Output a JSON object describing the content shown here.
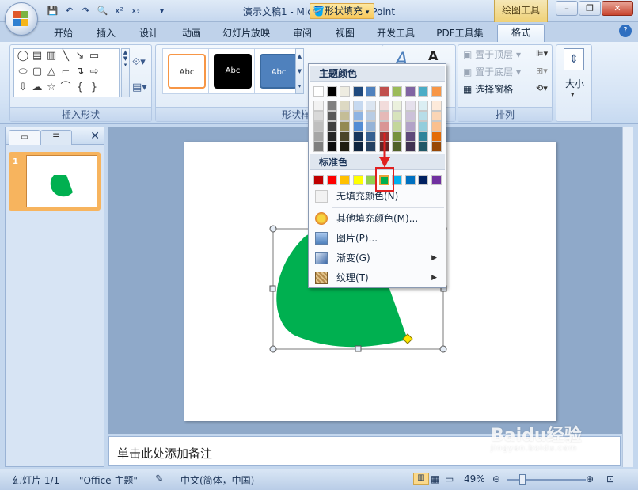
{
  "window": {
    "title": "演示文稿1 - Microsoft PowerPoint",
    "context_tab_title": "绘图工具",
    "controls": [
      "–",
      "❐",
      "✕"
    ]
  },
  "qat": [
    "💾",
    "↶",
    "↷",
    "🔍",
    "x²",
    "x₂",
    "▾"
  ],
  "ribbon_tabs": [
    "开始",
    "插入",
    "设计",
    "动画",
    "幻灯片放映",
    "审阅",
    "视图",
    "开发工具",
    "PDF工具集",
    "格式"
  ],
  "active_tab": "格式",
  "groups": {
    "insert_shapes": "插入形状",
    "shape_styles": "形状样式",
    "arrange": "排列"
  },
  "style_gallery": [
    "Abc",
    "Abc",
    "Abc"
  ],
  "shape_fill_button": "形状填充",
  "arrange_buttons": {
    "bring_front": "置于顶层",
    "send_back": "置于底层",
    "selection_pane": "选择窗格",
    "size": "大小"
  },
  "dropdown": {
    "theme_colors_label": "主题颜色",
    "standard_colors_label": "标准色",
    "theme_top_row": [
      "#ffffff",
      "#000000",
      "#eeece1",
      "#1f497d",
      "#4f81bd",
      "#c0504d",
      "#9bbb59",
      "#8064a2",
      "#4bacc6",
      "#f79646"
    ],
    "theme_columns": [
      [
        "#f2f2f2",
        "#d9d9d9",
        "#bfbfbf",
        "#a6a6a6",
        "#7f7f7f"
      ],
      [
        "#7f7f7f",
        "#595959",
        "#404040",
        "#262626",
        "#0d0d0d"
      ],
      [
        "#ddd9c3",
        "#c4bd97",
        "#948a54",
        "#4a452a",
        "#1e1c11"
      ],
      [
        "#c6d9f0",
        "#8db3e2",
        "#548dd4",
        "#17365d",
        "#0f243e"
      ],
      [
        "#dbe5f1",
        "#b8cce4",
        "#95b3d7",
        "#366092",
        "#244061"
      ],
      [
        "#f2dcdb",
        "#e5b9b7",
        "#d99694",
        "#953734",
        "#632423"
      ],
      [
        "#ebf1dd",
        "#d7e3bc",
        "#c3d69b",
        "#76923c",
        "#4f6128"
      ],
      [
        "#e5e0ec",
        "#ccc1d9",
        "#b2a2c7",
        "#5f497a",
        "#3f3151"
      ],
      [
        "#dbeef3",
        "#b7dde8",
        "#92cddc",
        "#31859b",
        "#205867"
      ],
      [
        "#fdeada",
        "#fbd5b5",
        "#fac08f",
        "#e36c09",
        "#974806"
      ]
    ],
    "standard_colors": [
      "#c00000",
      "#ff0000",
      "#ffc000",
      "#ffff00",
      "#92d050",
      "#00b050",
      "#00b0f0",
      "#0070c0",
      "#002060",
      "#7030a0"
    ],
    "selected_standard_index": 5,
    "items": [
      {
        "label": "无填充颜色(N)",
        "icon": "no-fill-icon"
      },
      {
        "label": "其他填充颜色(M)...",
        "icon": "palette-icon"
      },
      {
        "label": "图片(P)...",
        "icon": "picture-icon"
      },
      {
        "label": "渐变(G)",
        "icon": "gradient-icon",
        "submenu": true
      },
      {
        "label": "纹理(T)",
        "icon": "texture-icon",
        "submenu": true
      }
    ]
  },
  "slide_panel": {
    "slide_number": "1",
    "shape_color": "#00b050"
  },
  "notes_placeholder": "单击此处添加备注",
  "status": {
    "slide_info": "幻灯片 1/1",
    "theme": "\"Office 主题\"",
    "language": "中文(简体，中国)",
    "zoom": "49%"
  },
  "watermark": {
    "brand": "Baidu经验",
    "url": "jingyan.baidu.com"
  }
}
